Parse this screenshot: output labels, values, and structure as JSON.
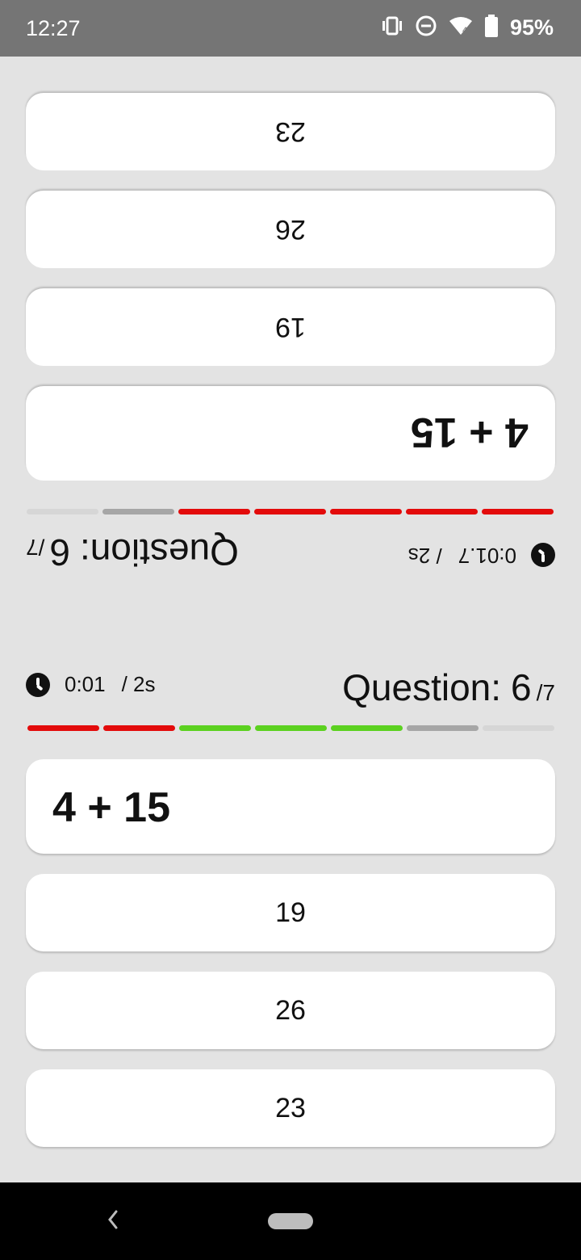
{
  "status_bar": {
    "time": "12:27",
    "battery_percent": "95%",
    "icons": [
      "vibrate-icon",
      "do-not-disturb-icon",
      "wifi-icon",
      "battery-icon"
    ]
  },
  "colors": {
    "background": "#e3e3e3",
    "card": "#ffffff",
    "correct": "#5bd11f",
    "wrong": "#e30b0b",
    "current": "#a6a6a6",
    "pending": "#d6d6d6"
  },
  "player_top": {
    "timer": {
      "elapsed": "0:01.7",
      "limit": "/ 2s"
    },
    "question": {
      "label": "Question:",
      "current": "6",
      "total": "/7"
    },
    "progress": [
      "wrong",
      "wrong",
      "wrong",
      "wrong",
      "wrong",
      "current",
      "pending"
    ],
    "expression": "4 + 15",
    "answers": [
      "19",
      "26",
      "23"
    ]
  },
  "player_bottom": {
    "timer": {
      "elapsed": "0:01",
      "limit": "/ 2s"
    },
    "question": {
      "label": "Question:",
      "current": "6",
      "total": "/7"
    },
    "progress": [
      "wrong",
      "wrong",
      "correct",
      "correct",
      "correct",
      "current",
      "pending"
    ],
    "expression": "4 + 15",
    "answers": [
      "19",
      "26",
      "23"
    ]
  },
  "nav_bar": {
    "back_icon": "back-icon",
    "home_icon": "home-pill-icon"
  }
}
